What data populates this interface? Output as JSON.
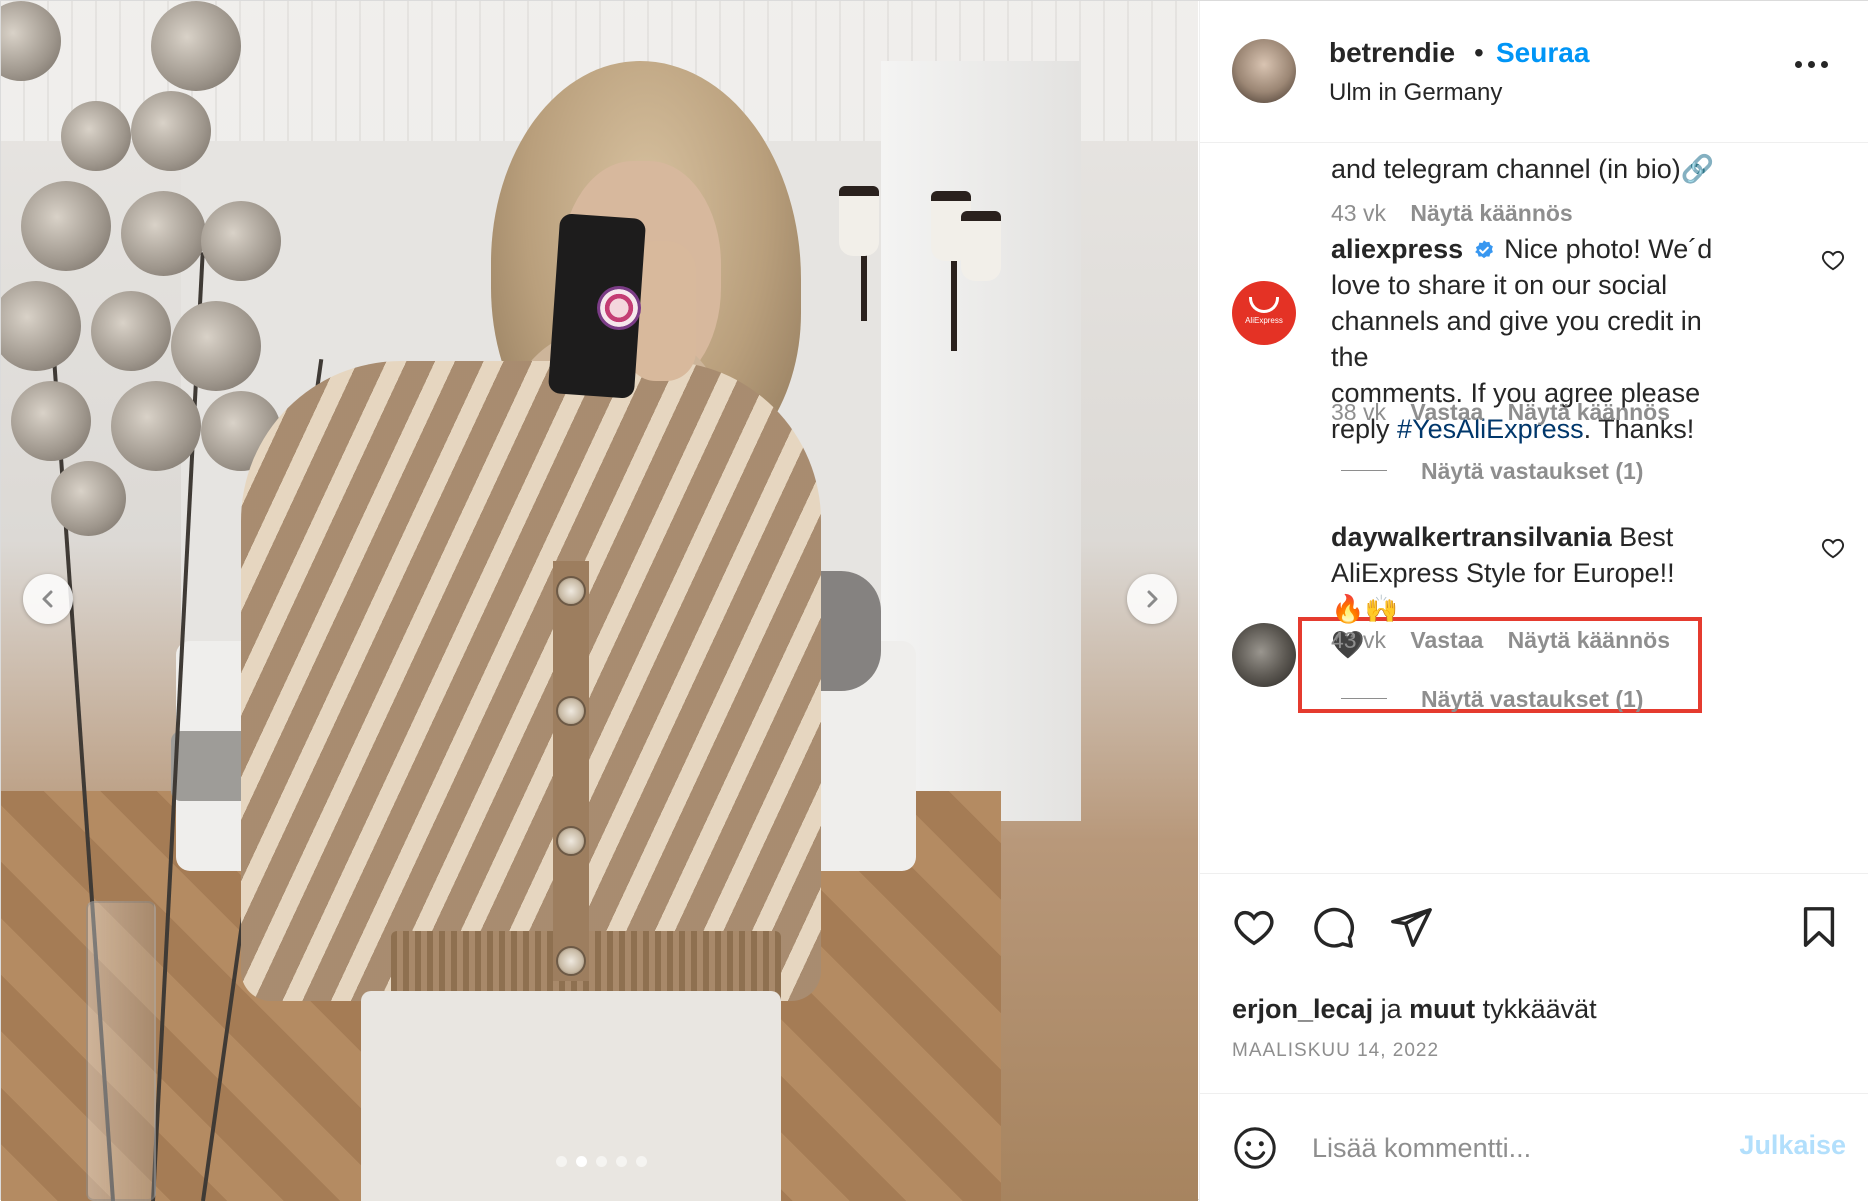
{
  "post": {
    "username": "betrendie",
    "separator": "•",
    "follow_label": "Seuraa",
    "location": "Ulm in Germany",
    "more_icon": "more-horizontal-icon"
  },
  "carousel": {
    "slide_count": 5,
    "active_index": 1
  },
  "comments": [
    {
      "partial_text": "and telegram channel (in bio)🔗",
      "age": "43 vk",
      "translate": "Näytä käännös"
    },
    {
      "username": "aliexpress",
      "verified": true,
      "avatar_label": "AliExpress",
      "text_before_tag": "Nice photo! We´d love to share it on our social channels and give you credit in the comments. If you agree please reply",
      "line1": "Nice photo! We´d",
      "line2": "love to share it on our social",
      "line3": "channels and give you credit in the",
      "line4": "comments. If you agree please",
      "line5_pre": "reply",
      "hashtag": "#YesAliExpress",
      "line5_post": ". Thanks!",
      "age": "38 vk",
      "reply": "Vastaa",
      "translate": "Näytä käännös",
      "view_replies": "Näytä vastaukset (1)"
    },
    {
      "username": "daywalkertransilvania",
      "line1": "Best",
      "line2": "AliExpress Style for Europe!! 🔥🙌",
      "line3": "🖤",
      "age": "43 vk",
      "reply": "Vastaa",
      "translate": "Näytä käännös",
      "view_replies": "Näytä vastaukset (1)",
      "highlighted": true
    }
  ],
  "likes": {
    "first_user": "erjon_lecaj",
    "conjunction": "ja",
    "others": "muut",
    "suffix": "tykkäävät"
  },
  "date": "MAALISKUU 14, 2022",
  "add_comment": {
    "placeholder": "Lisää kommentti...",
    "post_label": "Julkaise"
  },
  "colors": {
    "link_blue": "#0095f6",
    "hashtag": "#00376b",
    "muted": "#8e8e8e",
    "highlight": "#e53b2f",
    "aliexpress_red": "#e43225"
  }
}
